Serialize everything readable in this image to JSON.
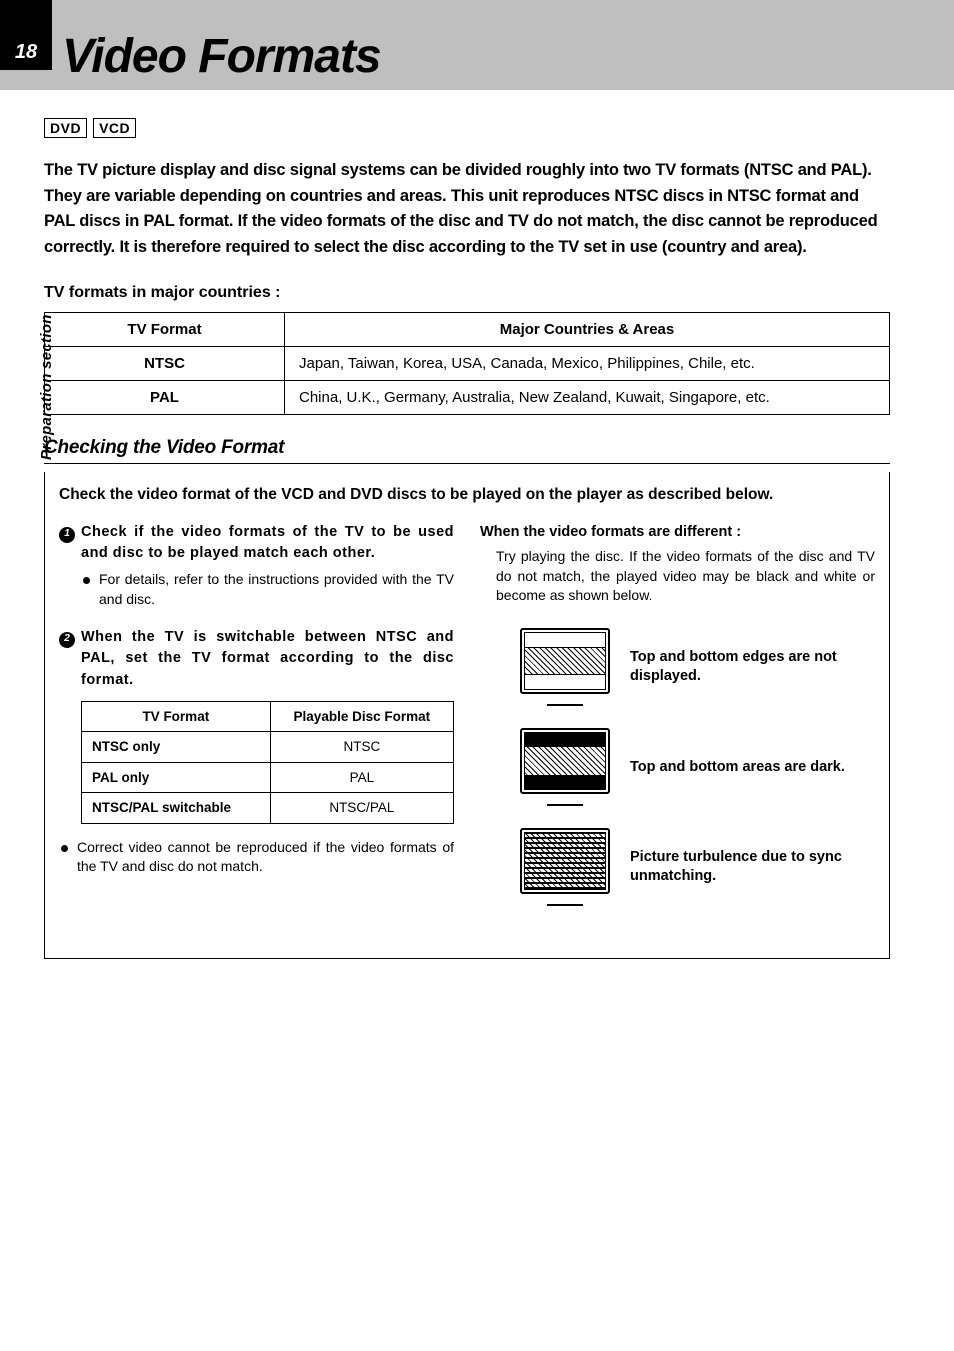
{
  "page_number": "18",
  "title": "Video Formats",
  "side_label": "Preparation section",
  "badges": [
    "DVD",
    "VCD"
  ],
  "intro": "The TV picture display and disc signal systems can be divided roughly into two TV formats (NTSC and PAL). They are variable depending on countries and areas.\nThis unit reproduces NTSC discs in NTSC format and PAL discs in PAL format. If the video formats of the disc and TV do not match, the disc cannot be reproduced correctly. It is therefore required to select the disc according to the TV set in use (country and area).",
  "formats_heading": "TV formats in major countries :",
  "formats_table": {
    "headers": [
      "TV Format",
      "Major Countries & Areas"
    ],
    "rows": [
      {
        "format": "NTSC",
        "areas": "Japan, Taiwan, Korea, USA, Canada, Mexico, Philippines, Chile, etc."
      },
      {
        "format": "PAL",
        "areas": "China, U.K., Germany, Australia, New Zealand, Kuwait, Singapore, etc."
      }
    ]
  },
  "section_heading": "Checking the Video Format",
  "section_lead": "Check the video format of the VCD and DVD discs to be played on the player as described below.",
  "steps": [
    {
      "num": "1",
      "title": "Check if the video formats of the TV to be used and disc to be played match each other.",
      "bullet": "For details, refer to the instructions provided with the TV and disc."
    },
    {
      "num": "2",
      "title": "When the TV is switchable between NTSC and PAL, set the TV format according to the disc format."
    }
  ],
  "inner_table": {
    "headers": [
      "TV Format",
      "Playable Disc Format"
    ],
    "rows": [
      {
        "tv": "NTSC only",
        "disc": "NTSC"
      },
      {
        "tv": "PAL only",
        "disc": "PAL"
      },
      {
        "tv": "NTSC/PAL switchable",
        "disc": "NTSC/PAL"
      }
    ]
  },
  "note_bullet": "Correct video cannot be reproduced if the video formats of the TV and disc do not match.",
  "right": {
    "heading": "When the video formats are different :",
    "para": "Try playing the disc. If the video formats of the disc and TV do not match, the played video may be black and white or become as shown below.",
    "items": [
      {
        "caption": "Top and bottom edges are not displayed."
      },
      {
        "caption": "Top and bottom areas are dark."
      },
      {
        "caption": "Picture turbulence due to sync unmatching."
      }
    ]
  }
}
